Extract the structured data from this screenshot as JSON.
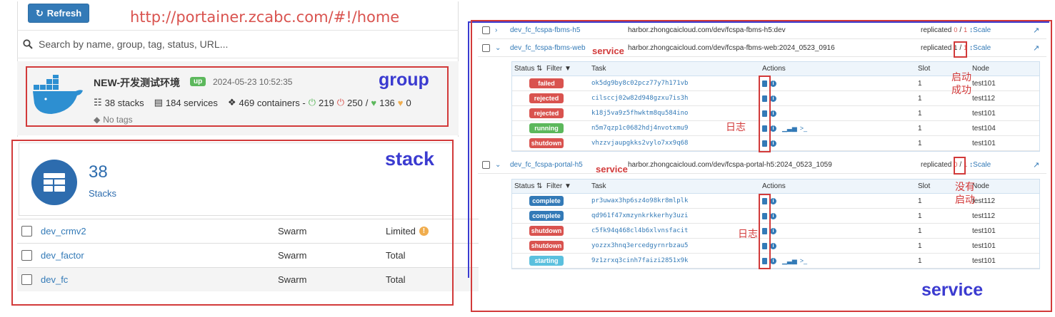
{
  "annotations": {
    "url": "http://portainer.zcabc.com/#!/home",
    "group": "group",
    "stack": "stack",
    "service_big": "service",
    "service_small_1": "service",
    "service_small_2": "service",
    "log_1": "日志",
    "log_2": "日志",
    "started_success": "启动\n成功",
    "not_started": "没有\n启动"
  },
  "home": {
    "refresh_label": "Refresh",
    "search_placeholder": "Search by name, group, tag, status, URL...",
    "endpoint": {
      "name": "NEW-开发测试环境",
      "status": "up",
      "date": "2024-05-23 10:52:35",
      "stacks": "38 stacks",
      "services": "184 services",
      "containers": "469 containers -",
      "running": "219",
      "stopped": "250",
      "slash": "/",
      "healthy": "136",
      "unhealthy": "0",
      "tags": "No tags"
    }
  },
  "stacks": {
    "count": "38",
    "label": "Stacks",
    "rows": [
      {
        "name": "dev_crmv2",
        "type": "Swarm",
        "control": "Limited",
        "warn": true
      },
      {
        "name": "dev_factor",
        "type": "Swarm",
        "control": "Total",
        "warn": false
      },
      {
        "name": "dev_fc",
        "type": "Swarm",
        "control": "Total",
        "warn": false
      }
    ]
  },
  "services": {
    "rows": [
      {
        "name": "dev_fc_fcspa-fbms-h5",
        "image": "harbor.zhongcaicloud.com/dev/fcspa-fbms-h5:dev",
        "mode": "replicated",
        "running": "0",
        "sep": "/",
        "desired": "1",
        "scale": "Scale",
        "expanded": false
      },
      {
        "name": "dev_fc_fcspa-fbms-web",
        "image": "harbor.zhongcaicloud.com/dev/fcspa-fbms-web:2024_0523_0916",
        "mode": "replicated",
        "running": "1",
        "sep": "/",
        "desired": "1",
        "scale": "Scale",
        "expanded": true
      },
      {
        "name": "dev_fc_fcspa-portal-h5",
        "image": "harbor.zhongcaicloud.com/dev/fcspa-portal-h5:2024_0523_1059",
        "mode": "replicated",
        "running": "0",
        "sep": "/",
        "desired": "1",
        "scale": "Scale",
        "expanded": true
      }
    ],
    "task_headers": {
      "status": "Status",
      "filter": "Filter",
      "task": "Task",
      "actions": "Actions",
      "slot": "Slot",
      "node": "Node"
    },
    "tasks_web": [
      {
        "status": "failed",
        "color": "#d9534f",
        "id": "ok5dg9by8c02pcz77y7h171vb",
        "slot": "1",
        "node": "test101",
        "extra": false
      },
      {
        "status": "rejected",
        "color": "#d9534f",
        "id": "cilsccj02w82d948gzxu7is3h",
        "slot": "1",
        "node": "test112",
        "extra": false
      },
      {
        "status": "rejected",
        "color": "#d9534f",
        "id": "k18j5va9z5fhwktm8qu584ino",
        "slot": "1",
        "node": "test101",
        "extra": false
      },
      {
        "status": "running",
        "color": "#5cb85c",
        "id": "n5m7qzp1c0682hdj4nvotxmu9",
        "slot": "1",
        "node": "test104",
        "extra": true
      },
      {
        "status": "shutdown",
        "color": "#d9534f",
        "id": "vhzzvjaupgkks2vylo7xx9q68",
        "slot": "1",
        "node": "test101",
        "extra": false
      }
    ],
    "tasks_portal": [
      {
        "status": "complete",
        "color": "#337ab7",
        "id": "pr3uwax3hp6sz4o98kr8mlplk",
        "slot": "1",
        "node": "test112",
        "extra": false
      },
      {
        "status": "complete",
        "color": "#337ab7",
        "id": "qd961f47xmzynkrkkerhy3uzi",
        "slot": "1",
        "node": "test112",
        "extra": false
      },
      {
        "status": "shutdown",
        "color": "#d9534f",
        "id": "c5fk94q468cl4b6xlvnsfacit",
        "slot": "1",
        "node": "test101",
        "extra": false
      },
      {
        "status": "shutdown",
        "color": "#d9534f",
        "id": "yozzx3hnq3ercedgyrnrbzau5",
        "slot": "1",
        "node": "test101",
        "extra": false
      },
      {
        "status": "starting",
        "color": "#5bc0de",
        "id": "9z1zrxq3cinh7faizi2851x9k",
        "slot": "1",
        "node": "test101",
        "extra": true
      }
    ]
  }
}
